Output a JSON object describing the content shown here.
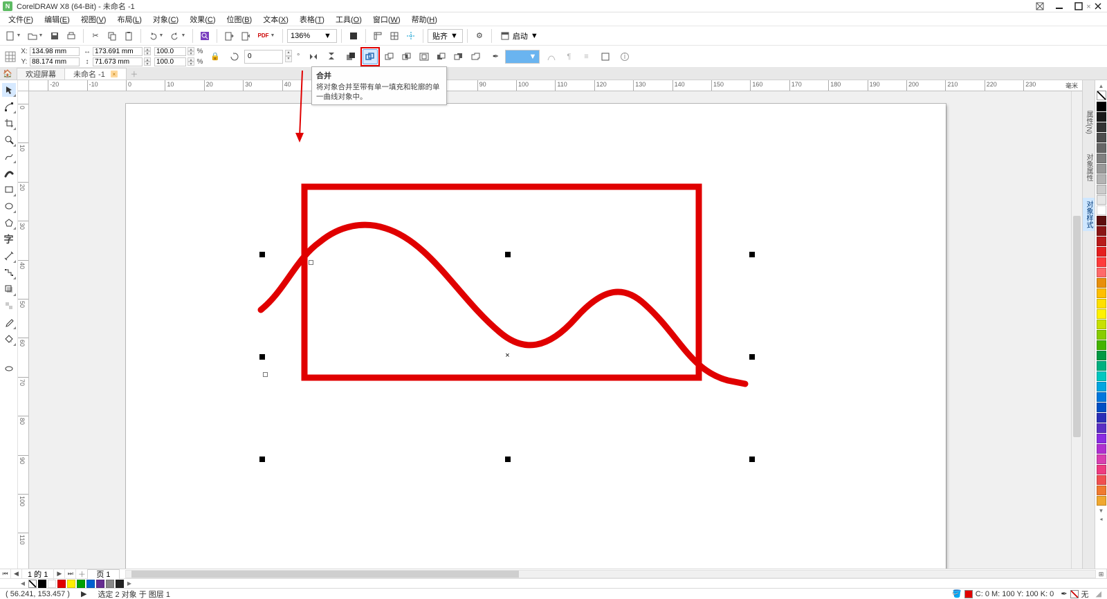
{
  "titlebar": {
    "title": "CorelDRAW X8 (64-Bit) - 未命名 -1"
  },
  "menu": {
    "items": [
      {
        "label": "文件",
        "key": "F"
      },
      {
        "label": "编辑",
        "key": "E"
      },
      {
        "label": "视图",
        "key": "V"
      },
      {
        "label": "布局",
        "key": "L"
      },
      {
        "label": "对象",
        "key": "C"
      },
      {
        "label": "效果",
        "key": "C"
      },
      {
        "label": "位图",
        "key": "B"
      },
      {
        "label": "文本",
        "key": "X"
      },
      {
        "label": "表格",
        "key": "T"
      },
      {
        "label": "工具",
        "key": "O"
      },
      {
        "label": "窗口",
        "key": "W"
      },
      {
        "label": "帮助",
        "key": "H"
      }
    ]
  },
  "toolbar1": {
    "zoom": "136%",
    "snap_label": "贴齐",
    "launch_label": "启动"
  },
  "propbar": {
    "x_label": "X:",
    "y_label": "Y:",
    "x": "134.98 mm",
    "y": "88.174 mm",
    "w": "173.691 mm",
    "h": "71.673 mm",
    "sx": "100.0",
    "sy": "100.0",
    "rot": "0",
    "pct": "%",
    "deg": "°"
  },
  "tooltip": {
    "title": "合并",
    "body": "将对象合并至带有单一填充和轮廓的单一曲线对象中。"
  },
  "tabs": {
    "welcome": "欢迎屏幕",
    "doc": "未命名 -1"
  },
  "ruler": {
    "unit": "毫米",
    "h_start": -20,
    "h_end": 230,
    "h_step": 10,
    "v_start": 0,
    "v_end": 110,
    "v_step": 10
  },
  "pagenav": {
    "counter": "1 的 1",
    "pagetab": "页 1"
  },
  "dockers": {
    "tabs": [
      "属性(N)",
      "对象属性",
      "对象样式"
    ]
  },
  "palette_colors": [
    "#000000",
    "#1a1a1a",
    "#333333",
    "#4d4d4d",
    "#666666",
    "#808080",
    "#999999",
    "#b3b3b3",
    "#cccccc",
    "#e6e6e6",
    "#ffffff",
    "#5e0f0f",
    "#8a1515",
    "#b91b1b",
    "#e51f1f",
    "#ff3b3b",
    "#ff6a6a",
    "#e88f0b",
    "#ffbf00",
    "#ffe000",
    "#fff200",
    "#c7e000",
    "#88cc00",
    "#44b400",
    "#009944",
    "#00b080",
    "#00c7c0",
    "#00a6e0",
    "#0077dd",
    "#004fc4",
    "#2b2fb7",
    "#5a2fc4",
    "#8a2be2",
    "#b02fd0",
    "#d83fb0",
    "#ee3b80",
    "#f04f50",
    "#f07a30",
    "#f0a830"
  ],
  "horizontal_palette": [
    "#000000",
    "#ffffff",
    "#e00000",
    "#ffee00",
    "#00a000",
    "#0060d0",
    "#662d91",
    "#888888",
    "#222222"
  ],
  "statusbar": {
    "cursor": "( 56.241, 153.457 )",
    "selection": "选定 2 对象 于 图层 1",
    "fill_label": "C: 0 M: 100 Y: 100 K: 0",
    "outline_label": "无"
  }
}
